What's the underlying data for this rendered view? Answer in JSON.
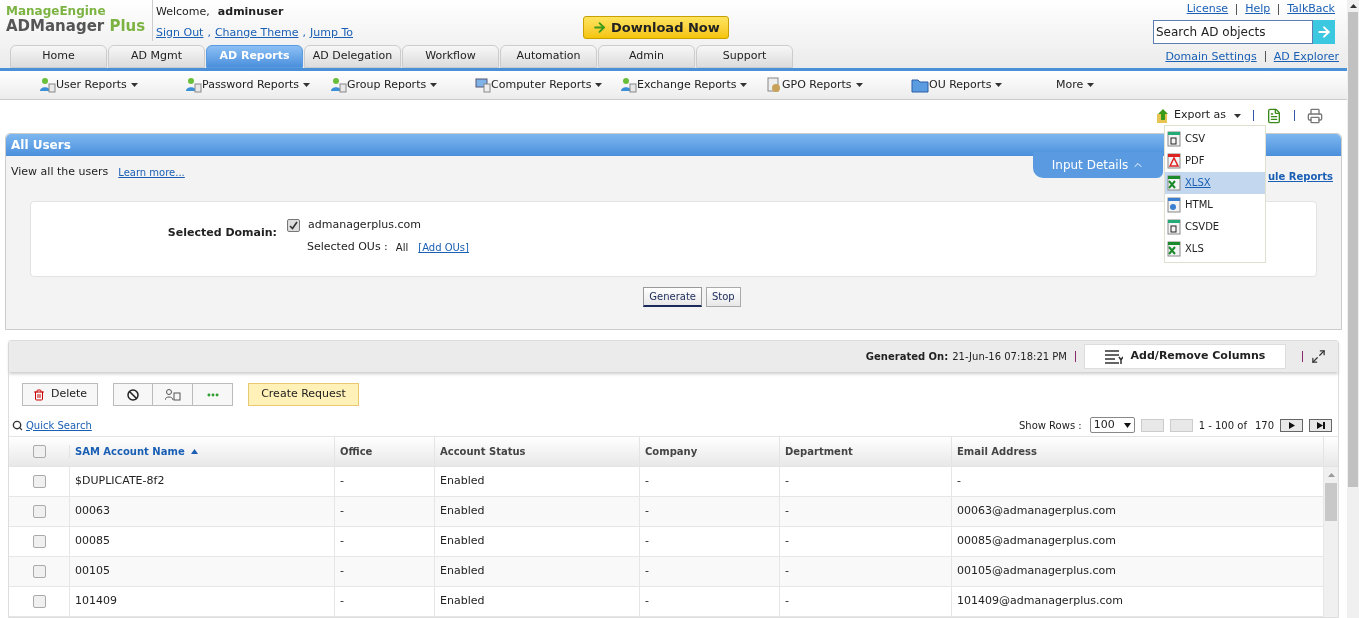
{
  "header": {
    "brand_top": "ManageEngine",
    "product": "ADManager",
    "product_suffix": "Plus",
    "welcome": "Welcome,",
    "user": "adminuser",
    "user_links": [
      "Sign Out",
      "Change Theme",
      "Jump To"
    ],
    "link_separator": ",",
    "download": "Download Now",
    "top_links": [
      "License",
      "Help",
      "TalkBack"
    ],
    "search": {
      "placeholder": "Search AD objects"
    },
    "right_links": [
      "Domain Settings",
      "AD Explorer"
    ]
  },
  "tabs": [
    {
      "label": "Home",
      "selected": false
    },
    {
      "label": "AD Mgmt",
      "selected": false
    },
    {
      "label": "AD Reports",
      "selected": true
    },
    {
      "label": "AD Delegation",
      "selected": false
    },
    {
      "label": "Workflow",
      "selected": false
    },
    {
      "label": "Automation",
      "selected": false
    },
    {
      "label": "Admin",
      "selected": false
    },
    {
      "label": "Support",
      "selected": false
    }
  ],
  "subnav": [
    {
      "label": "User Reports",
      "kind": "users"
    },
    {
      "label": "Password Reports",
      "kind": "password"
    },
    {
      "label": "Group Reports",
      "kind": "users"
    },
    {
      "label": "Computer Reports",
      "kind": "computer"
    },
    {
      "label": "Exchange Reports",
      "kind": "mail"
    },
    {
      "label": "GPO Reports",
      "kind": "gpo"
    },
    {
      "label": "OU Reports",
      "kind": "folder"
    },
    {
      "label": "More",
      "kind": "none"
    }
  ],
  "export": {
    "label": "Export as",
    "menu": [
      {
        "label": "CSV",
        "kind": "csv",
        "selected": false
      },
      {
        "label": "PDF",
        "kind": "pdf",
        "selected": false
      },
      {
        "label": "XLSX",
        "kind": "xls",
        "selected": true
      },
      {
        "label": "HTML",
        "kind": "html",
        "selected": false
      },
      {
        "label": "CSVDE",
        "kind": "csv",
        "selected": false
      },
      {
        "label": "XLS",
        "kind": "xls",
        "selected": false
      }
    ]
  },
  "panel": {
    "title": "All Users",
    "description": "View all the users",
    "learn_more": "Learn more...",
    "input_details": "Input Details",
    "schedule_link": "ule Reports",
    "domain_label": "Selected Domain:",
    "domain": {
      "name": "admanagerplus.com",
      "checked": true
    },
    "ous_label": "Selected OUs :",
    "ous_value": "All",
    "add_ous": "[Add OUs]",
    "buttons": [
      "Generate",
      "Stop"
    ]
  },
  "results": {
    "generated_label": "Generated On:",
    "generated_value": "21-Jun-16 07:18:21 PM",
    "add_remove": "Add/Remove Columns",
    "delete": "Delete",
    "create_request": "Create Request",
    "quick_search": "Quick Search",
    "show_rows_label": "Show Rows :",
    "show_rows": "100",
    "page_range": "1 - 100 of",
    "total": "170"
  },
  "table": {
    "columns": [
      {
        "label": "SAM Account Name",
        "sorted": true
      },
      {
        "label": "Office",
        "sorted": false
      },
      {
        "label": "Account Status",
        "sorted": false
      },
      {
        "label": "Company",
        "sorted": false
      },
      {
        "label": "Department",
        "sorted": false
      },
      {
        "label": "Email Address",
        "sorted": false
      }
    ],
    "header_checked": false,
    "rows": [
      {
        "checked": false,
        "cells": [
          "$DUPLICATE-8f2",
          "-",
          "Enabled",
          "-",
          "-",
          "-"
        ]
      },
      {
        "checked": false,
        "cells": [
          "00063",
          "-",
          "Enabled",
          "-",
          "-",
          "00063@admanagerplus.com"
        ]
      },
      {
        "checked": false,
        "cells": [
          "00085",
          "-",
          "Enabled",
          "-",
          "-",
          "00085@admanagerplus.com"
        ]
      },
      {
        "checked": false,
        "cells": [
          "00105",
          "-",
          "Enabled",
          "-",
          "-",
          "00105@admanagerplus.com"
        ]
      },
      {
        "checked": false,
        "cells": [
          "101409",
          "-",
          "Enabled",
          "-",
          "-",
          "101409@admanagerplus.com"
        ]
      }
    ]
  }
}
